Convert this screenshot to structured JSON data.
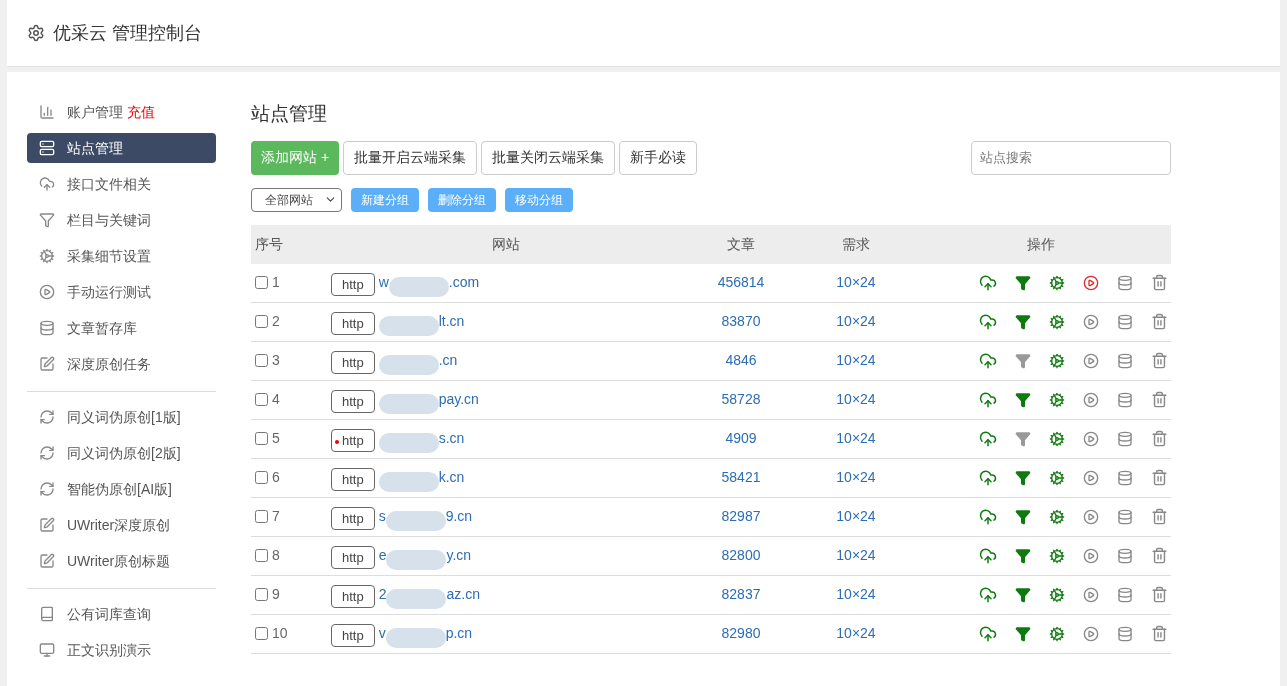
{
  "header": {
    "title": "优采云 管理控制台"
  },
  "sidebar": {
    "groups": [
      {
        "items": [
          {
            "label": "账户管理",
            "badge": "充值",
            "selected": false
          },
          {
            "label": "站点管理",
            "selected": true
          },
          {
            "label": "接口文件相关",
            "selected": false
          },
          {
            "label": "栏目与关键词",
            "selected": false
          },
          {
            "label": "采集细节设置",
            "selected": false
          },
          {
            "label": "手动运行测试",
            "selected": false
          },
          {
            "label": "文章暂存库",
            "selected": false
          },
          {
            "label": "深度原创任务",
            "selected": false
          }
        ]
      },
      {
        "items": [
          {
            "label": "同义词伪原创[1版]",
            "selected": false
          },
          {
            "label": "同义词伪原创[2版]",
            "selected": false
          },
          {
            "label": "智能伪原创[AI版]",
            "selected": false
          },
          {
            "label": "UWriter深度原创",
            "selected": false
          },
          {
            "label": "UWriter原创标题",
            "selected": false
          }
        ]
      },
      {
        "items": [
          {
            "label": "公有词库查询",
            "selected": false
          },
          {
            "label": "正文识别演示",
            "selected": false
          }
        ]
      }
    ]
  },
  "main": {
    "title": "站点管理",
    "toolbar": [
      {
        "label": "添加网站 +",
        "kind": "primary"
      },
      {
        "label": "批量开启云端采集",
        "kind": "default"
      },
      {
        "label": "批量关闭云端采集",
        "kind": "default"
      },
      {
        "label": "新手必读",
        "kind": "default"
      }
    ],
    "search": {
      "placeholder": "站点搜索"
    },
    "group_select": {
      "value": "全部网站"
    },
    "group_buttons": [
      "新建分组",
      "删除分组",
      "移动分组"
    ],
    "table": {
      "columns": [
        "序号",
        "网站",
        "文章",
        "需求",
        "操作"
      ],
      "rows": [
        {
          "index": "1",
          "scheme": "http",
          "url_prefix": "w",
          "url_suffix": ".com",
          "articles": "456814",
          "demand": "10×24",
          "checked": false,
          "alert": false,
          "filter_on": true,
          "running": true
        },
        {
          "index": "2",
          "scheme": "http",
          "url_prefix": "",
          "url_suffix": "lt.cn",
          "articles": "83870",
          "demand": "10×24",
          "checked": false,
          "alert": false,
          "filter_on": true,
          "running": false
        },
        {
          "index": "3",
          "scheme": "http",
          "url_prefix": "",
          "url_suffix": ".cn",
          "articles": "4846",
          "demand": "10×24",
          "checked": false,
          "alert": false,
          "filter_on": false,
          "running": false
        },
        {
          "index": "4",
          "scheme": "http",
          "url_prefix": "",
          "url_suffix": "pay.cn",
          "articles": "58728",
          "demand": "10×24",
          "checked": false,
          "alert": false,
          "filter_on": true,
          "running": false
        },
        {
          "index": "5",
          "scheme": "http",
          "url_prefix": "",
          "url_suffix": "s.cn",
          "articles": "4909",
          "demand": "10×24",
          "checked": false,
          "alert": true,
          "filter_on": false,
          "running": false
        },
        {
          "index": "6",
          "scheme": "http",
          "url_prefix": "",
          "url_suffix": "k.cn",
          "articles": "58421",
          "demand": "10×24",
          "checked": false,
          "alert": false,
          "filter_on": true,
          "running": false
        },
        {
          "index": "7",
          "scheme": "http",
          "url_prefix": "s",
          "url_suffix": "9.cn",
          "articles": "82987",
          "demand": "10×24",
          "checked": false,
          "alert": false,
          "filter_on": true,
          "running": false
        },
        {
          "index": "8",
          "scheme": "http",
          "url_prefix": "e",
          "url_suffix": "y.cn",
          "articles": "82800",
          "demand": "10×24",
          "checked": false,
          "alert": false,
          "filter_on": true,
          "running": false
        },
        {
          "index": "9",
          "scheme": "http",
          "url_prefix": "2",
          "url_suffix": "az.cn",
          "articles": "82837",
          "demand": "10×24",
          "checked": false,
          "alert": false,
          "filter_on": true,
          "running": false
        },
        {
          "index": "10",
          "scheme": "http",
          "url_prefix": "v",
          "url_suffix": "p.cn",
          "articles": "82980",
          "demand": "10×24",
          "checked": false,
          "alert": false,
          "filter_on": true,
          "running": false
        }
      ]
    }
  }
}
